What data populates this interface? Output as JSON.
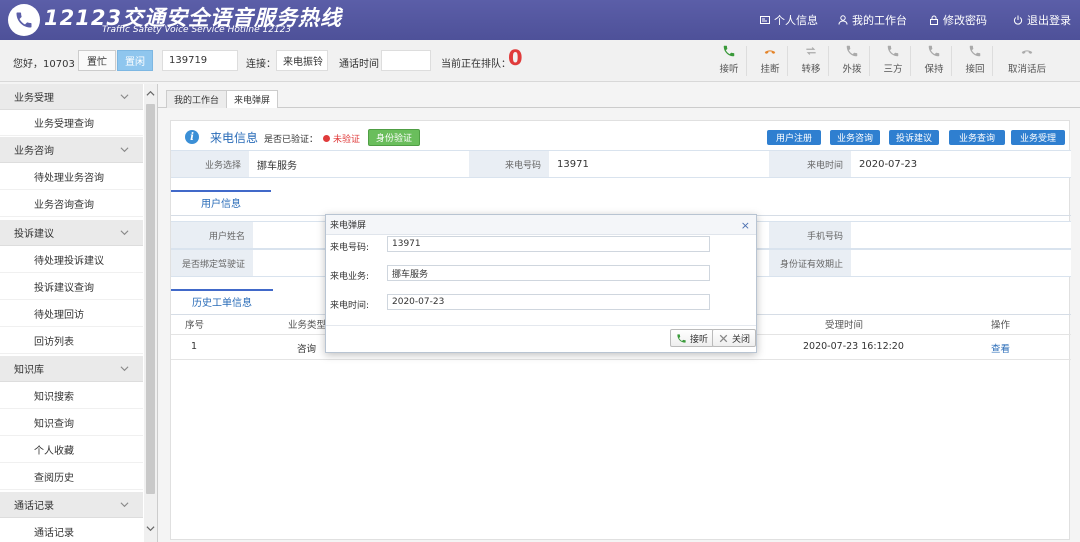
{
  "header": {
    "title": "12123交通安全语音服务热线",
    "subtitle": "Traffic Safety Voice Service Hotline 12123",
    "links": [
      "个人信息",
      "我的工作台",
      "修改密码",
      "退出登录"
    ]
  },
  "toolbar": {
    "greeting": "您好，10703",
    "busy_label": "置忙",
    "idle_label": "置闲",
    "phone_value": "139719",
    "connect_label": "连接：",
    "connect_value": "来电振铃",
    "call_time_label": "通话时间",
    "call_time_value": "",
    "queue_label": "当前正在排队：",
    "queue_count": "0",
    "actions": [
      "接听",
      "挂断",
      "转移",
      "外拨",
      "三方",
      "保持",
      "接回",
      "取消话后"
    ]
  },
  "sidebar": {
    "groups": [
      {
        "label": "业务受理",
        "items": [
          "业务受理查询"
        ]
      },
      {
        "label": "业务咨询",
        "items": [
          "待处理业务咨询",
          "业务咨询查询"
        ]
      },
      {
        "label": "投诉建议",
        "items": [
          "待处理投诉建议",
          "投诉建议查询",
          "待处理回访",
          "回访列表"
        ]
      },
      {
        "label": "知识库",
        "items": [
          "知识搜索",
          "知识查询",
          "个人收藏",
          "查阅历史"
        ]
      },
      {
        "label": "通话记录",
        "items": [
          "通话记录"
        ]
      }
    ]
  },
  "tabs": [
    "我的工作台",
    "来电弹屏"
  ],
  "incoming": {
    "title": "来电信息",
    "verified_label": "是否已验证：",
    "verified_status": "未验证",
    "id_verify_label": "身份验证",
    "actions": [
      "用户注册",
      "业务咨询",
      "投诉建议",
      "业务查询",
      "业务受理"
    ],
    "business_type_label": "业务选择",
    "business_type_value": "挪车服务",
    "caller_number_label": "来电号码",
    "caller_number_value": "13971",
    "call_time_label": "来电时间",
    "call_time_value": "2020-07-23"
  },
  "user_info": {
    "tab_label": "用户信息",
    "name_label": "用户姓名",
    "name_value": "",
    "mobile_label": "手机号码",
    "mobile_value": "",
    "bound_label": "是否绑定驾驶证",
    "bound_value": "",
    "id_valid_label": "身份证有效期止",
    "id_valid_value": ""
  },
  "history": {
    "tab_label": "历史工单信息",
    "columns": [
      "序号",
      "业务类型",
      "受理时间",
      "操作"
    ],
    "rows": [
      {
        "no": "1",
        "type": "咨询",
        "time": "2020-07-23 16:12:20",
        "action": "查看"
      }
    ]
  },
  "dialog": {
    "title": "来电弹屏",
    "close_symbol": "×",
    "number_label": "来电号码:",
    "number_value": "13971",
    "business_label": "来电业务:",
    "business_value": "挪车服务",
    "time_label": "来电时间:",
    "time_value": "2020-07-23",
    "answer_label": "接听",
    "close_label": "关闭"
  },
  "colors": {
    "header_bg": "#5b5ea8",
    "action_blue": "#2f7fd0",
    "verify_green": "#6abe5c",
    "alert_red": "#e03b3b",
    "answer_green": "#3a9a3a",
    "hangup_orange": "#e4842a"
  }
}
